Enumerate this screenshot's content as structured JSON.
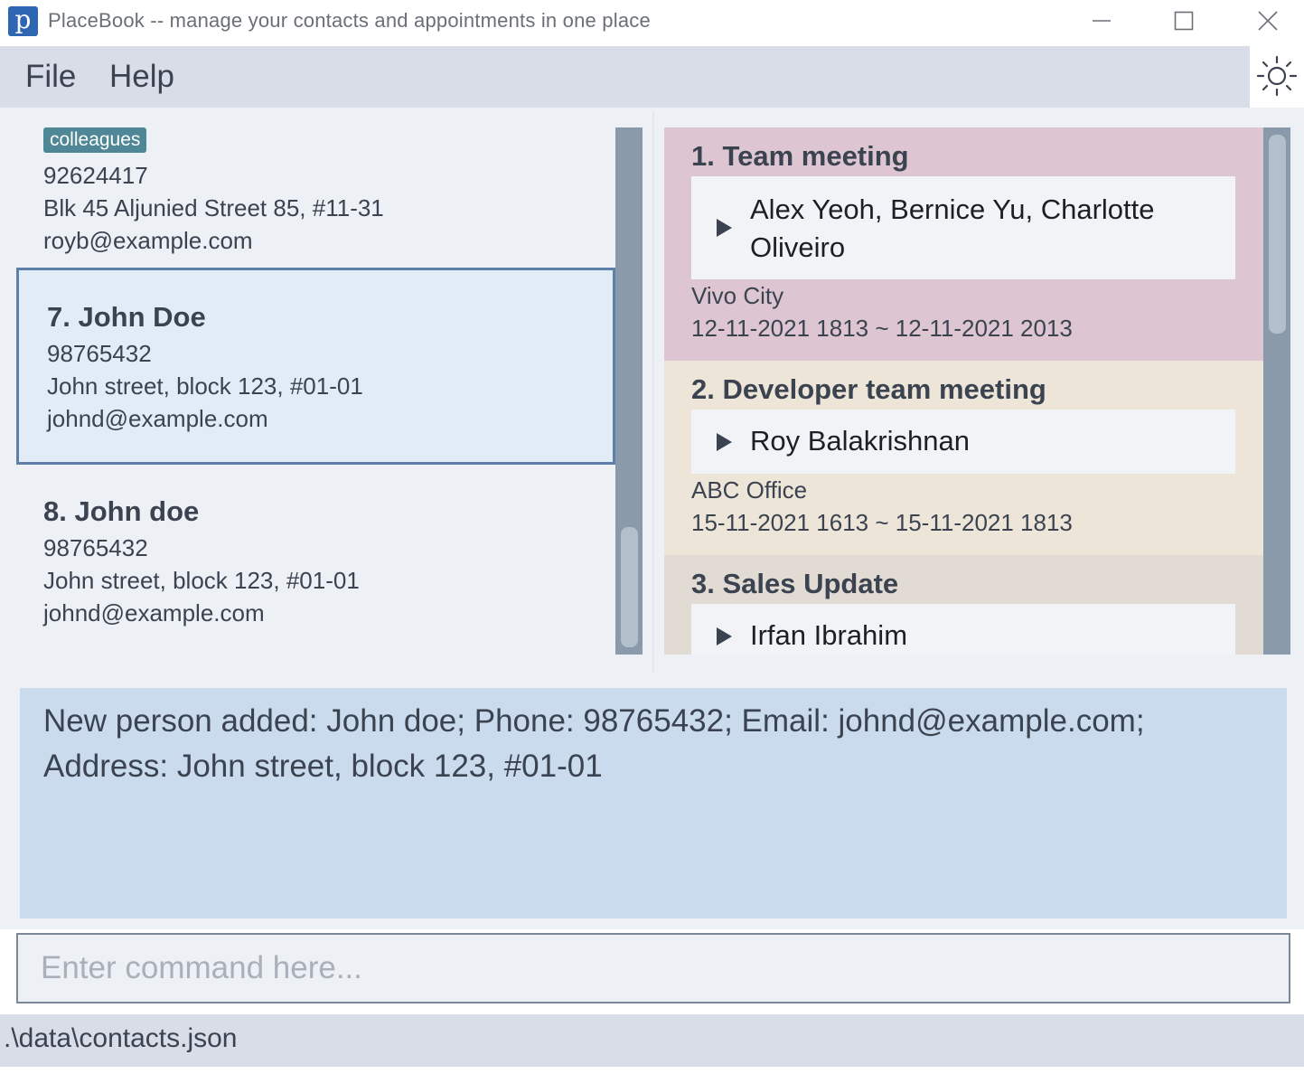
{
  "window": {
    "app_icon_letter": "p",
    "title": "PlaceBook -- manage your contacts and appointments in one place"
  },
  "menu": {
    "file": "File",
    "help": "Help"
  },
  "persons": [
    {
      "tag": "colleagues",
      "phone": "92624417",
      "address": "Blk 45 Aljunied Street 85, #11-31",
      "email": "royb@example.com"
    },
    {
      "name": "7.  John Doe",
      "phone": "98765432",
      "address": "John street, block 123, #01-01",
      "email": "johnd@example.com",
      "selected": true
    },
    {
      "name": "8.  John doe",
      "phone": "98765432",
      "address": "John street, block 123, #01-01",
      "email": "johnd@example.com"
    }
  ],
  "appointments": [
    {
      "title": "1.  Team meeting",
      "clients_line1": "Alex Yeoh, Bernice Yu, Charlotte",
      "clients_line2": "Oliveiro",
      "location": "Vivo City",
      "time": "12-11-2021 1813  ~  12-11-2021 2013",
      "color": "#ddc6d1"
    },
    {
      "title": "2.  Developer team meeting",
      "clients_line1": "Roy Balakrishnan",
      "location": "ABC Office",
      "time": "15-11-2021 1613  ~  15-11-2021 1813",
      "color": "#ede6d8"
    },
    {
      "title": "3.  Sales Update",
      "clients_line1": "Irfan Ibrahim",
      "color": "#e1dbd3"
    }
  ],
  "result": {
    "text": "New person added: John doe; Phone: 98765432; Email: johnd@example.com; Address: John street, block 123, #01-01"
  },
  "command": {
    "placeholder": "Enter command here..."
  },
  "status": {
    "path": ".\\data\\contacts.json"
  }
}
